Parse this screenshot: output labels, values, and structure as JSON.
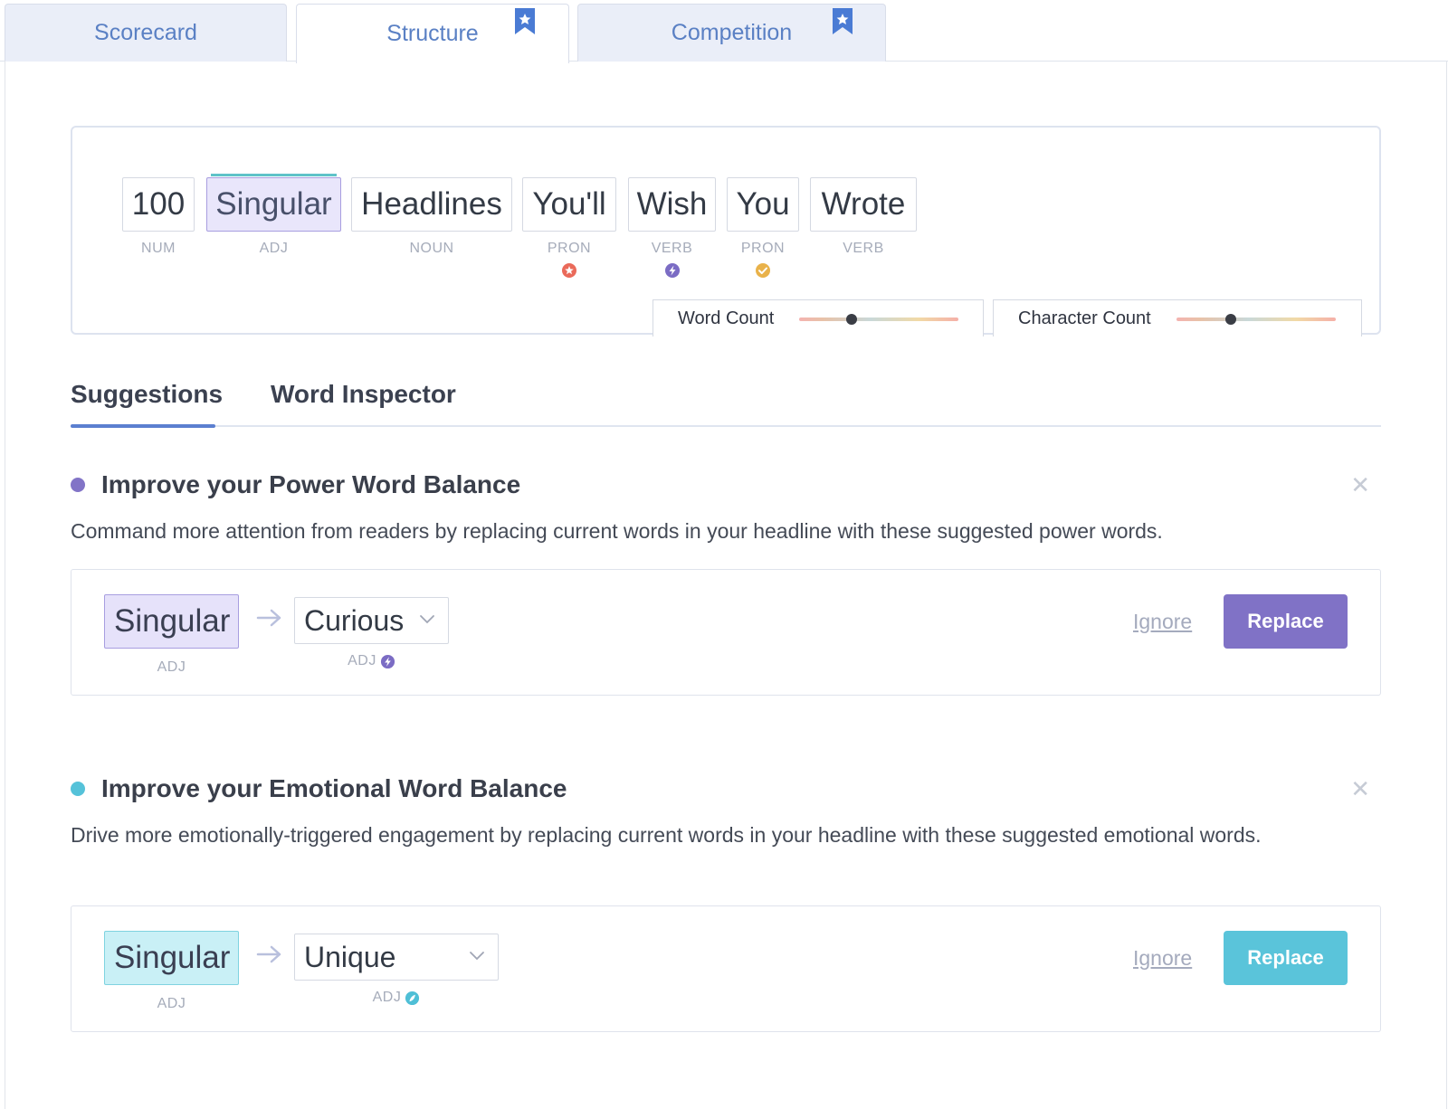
{
  "tabs": [
    {
      "label": "Scorecard",
      "bookmarked": false
    },
    {
      "label": "Structure",
      "bookmarked": true,
      "active": true
    },
    {
      "label": "Competition",
      "bookmarked": true
    }
  ],
  "headline": {
    "words": [
      {
        "text": "100",
        "pos": "NUM"
      },
      {
        "text": "Singular",
        "pos": "ADJ",
        "selected": true
      },
      {
        "text": "Headlines",
        "pos": "NOUN"
      },
      {
        "text": "You'll",
        "pos": "PRON",
        "badge": "star-badge-icon"
      },
      {
        "text": "Wish",
        "pos": "VERB",
        "badge": "bolt-badge-icon"
      },
      {
        "text": "You",
        "pos": "PRON",
        "badge": "check-badge-icon"
      },
      {
        "text": "Wrote",
        "pos": "VERB"
      }
    ],
    "meters": [
      {
        "label": "Word Count",
        "level": 0.33
      },
      {
        "label": "Character Count",
        "level": 0.34
      }
    ]
  },
  "subtabs": [
    {
      "label": "Suggestions",
      "active": true
    },
    {
      "label": "Word Inspector"
    }
  ],
  "suggestions": [
    {
      "title": "Improve your Power Word Balance",
      "description": "Command more attention from readers by replacing current words in your headline with these suggested power words.",
      "dot_color": "#8274c7",
      "original": {
        "text": "Singular",
        "pos": "ADJ"
      },
      "replacement": {
        "value": "Curious",
        "pos": "ADJ",
        "icon": "bolt-icon"
      },
      "ignore_label": "Ignore",
      "replace_label": "Replace",
      "accent": "#8072c6"
    },
    {
      "title": "Improve your Emotional Word Balance",
      "description": "Drive more emotionally-triggered engagement by replacing current words in your headline with these suggested emotional words.",
      "dot_color": "#55c2d9",
      "original": {
        "text": "Singular",
        "pos": "ADJ"
      },
      "replacement": {
        "value": "Unique",
        "pos": "ADJ",
        "icon": "emotion-icon"
      },
      "ignore_label": "Ignore",
      "replace_label": "Replace",
      "accent": "#5ac4da"
    }
  ]
}
